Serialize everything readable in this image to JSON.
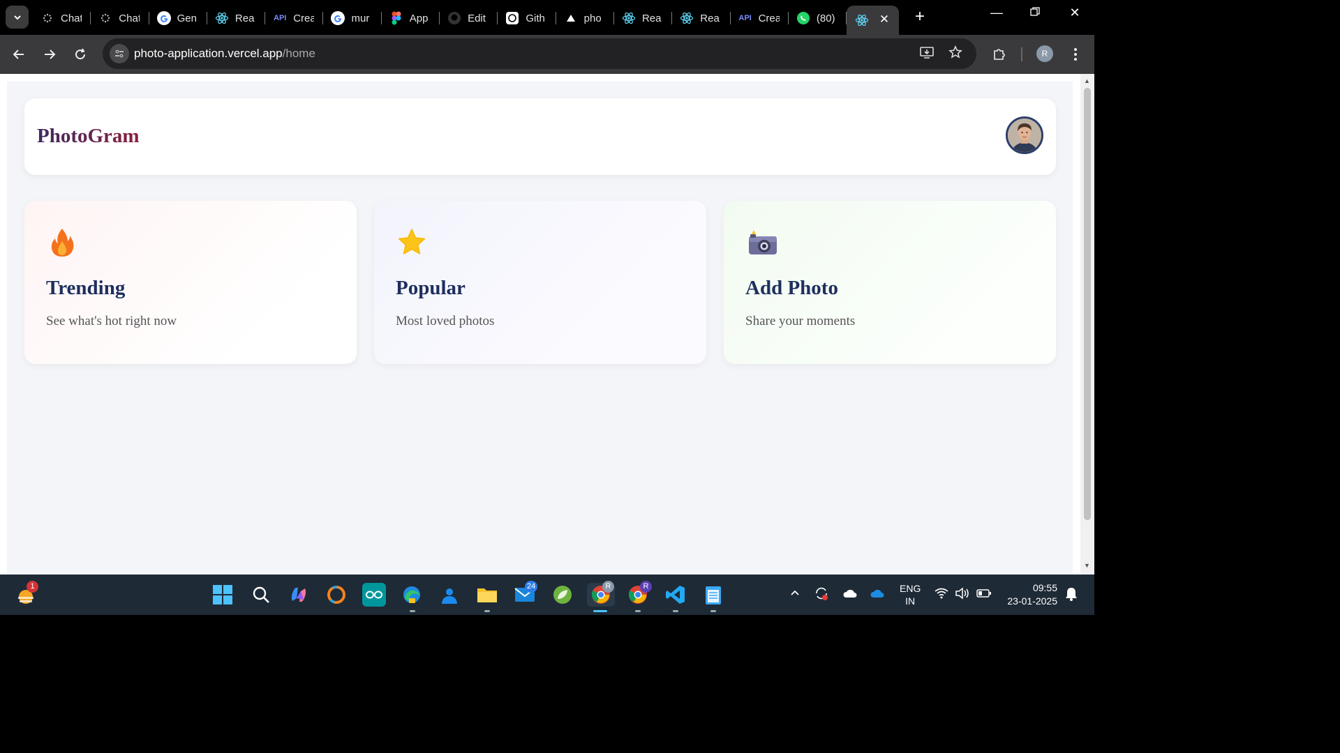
{
  "browser": {
    "tabs": [
      {
        "title": "Chat",
        "icon": "chatgpt-icon"
      },
      {
        "title": "Chat",
        "icon": "chatgpt-icon"
      },
      {
        "title": "Gen",
        "icon": "google-icon"
      },
      {
        "title": "Rea",
        "icon": "react-icon"
      },
      {
        "title": "Crea",
        "icon": "api-icon"
      },
      {
        "title": "mur",
        "icon": "google-icon"
      },
      {
        "title": "App",
        "icon": "figma-icon"
      },
      {
        "title": "Edit",
        "icon": "github-icon"
      },
      {
        "title": "Gith",
        "icon": "openai-icon"
      },
      {
        "title": "pho",
        "icon": "vercel-icon"
      },
      {
        "title": "Rea",
        "icon": "react-icon"
      },
      {
        "title": "Rea",
        "icon": "react-icon"
      },
      {
        "title": "Crea",
        "icon": "api-icon"
      },
      {
        "title": "(80)",
        "icon": "whatsapp-icon"
      }
    ],
    "api_icon_text": "API",
    "active_tab_icon": "react-icon",
    "url_host": "photo-application.vercel.app",
    "url_path": "/home",
    "profile_initial": "R"
  },
  "app": {
    "brand": "PhotoGram",
    "cards": [
      {
        "title": "Trending",
        "description": "See what's hot right now",
        "icon": "fire-icon"
      },
      {
        "title": "Popular",
        "description": "Most loved photos",
        "icon": "star-icon"
      },
      {
        "title": "Add Photo",
        "description": "Share your moments",
        "icon": "camera-icon"
      }
    ]
  },
  "taskbar": {
    "weather_badge": "1",
    "mail_badge": "24",
    "chrome_profile_1": "R",
    "chrome_profile_2": "R",
    "lang_line1": "ENG",
    "lang_line2": "IN",
    "time": "09:55",
    "date": "23-01-2025"
  },
  "colors": {
    "brand_gradient_start": "#3d2a60",
    "brand_gradient_end": "#8a1f3d",
    "card_title": "#1e2f5e",
    "page_bg": "#f4f5f9"
  }
}
